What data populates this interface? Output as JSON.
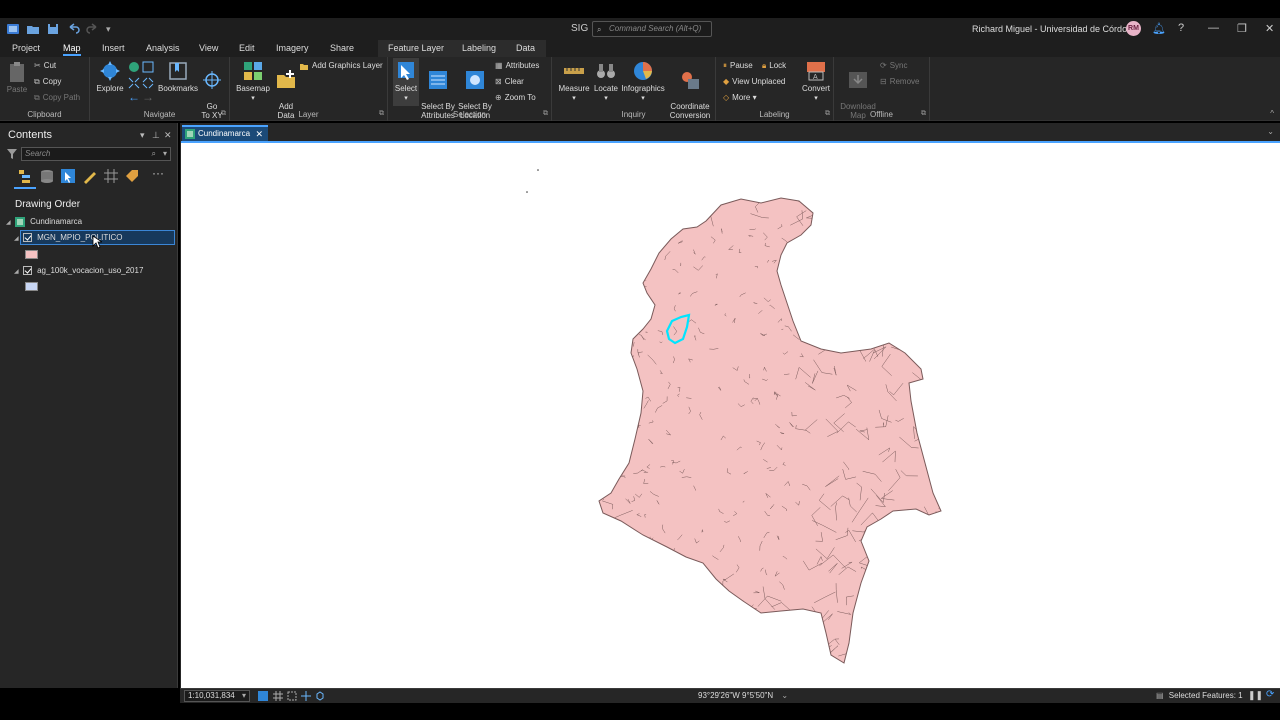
{
  "app": {
    "title": "SIG",
    "command_search_placeholder": "Command Search (Alt+Q)",
    "user": "Richard Miguel - Universidad de Córdoba",
    "avatar_initials": "RM"
  },
  "ribbon_tabs": [
    "Project",
    "Map",
    "Insert",
    "Analysis",
    "View",
    "Edit",
    "Imagery",
    "Share",
    "Feature Layer",
    "Labeling",
    "Data"
  ],
  "active_tab": "Map",
  "ribbon": {
    "clipboard": {
      "label": "Clipboard",
      "paste": "Paste",
      "cut": "Cut",
      "copy": "Copy",
      "copy_path": "Copy Path"
    },
    "navigate": {
      "label": "Navigate",
      "explore": "Explore",
      "bookmarks": "Bookmarks",
      "goto_xy": "Go\nTo XY"
    },
    "layer": {
      "label": "Layer",
      "basemap": "Basemap",
      "add_data": "Add\nData",
      "add_graphics": "Add Graphics Layer"
    },
    "selection": {
      "label": "Selection",
      "select": "Select",
      "by_attributes": "Select By\nAttributes",
      "by_location": "Select By\nLocation",
      "attributes": "Attributes",
      "clear": "Clear",
      "zoom_to": "Zoom To"
    },
    "inquiry": {
      "label": "Inquiry",
      "measure": "Measure",
      "locate": "Locate",
      "infographics": "Infographics",
      "coordinate_conversion": "Coordinate\nConversion"
    },
    "labeling": {
      "label": "Labeling",
      "pause": "Pause",
      "lock": "Lock",
      "view_unplaced": "View Unplaced",
      "more": "More",
      "convert": "Convert"
    },
    "offline": {
      "label": "Offline",
      "download_map": "Download\nMap",
      "sync": "Sync",
      "remove": "Remove"
    }
  },
  "contents": {
    "title": "Contents",
    "search_placeholder": "Search",
    "drawing_order": "Drawing Order",
    "map_name": "Cundinamarca",
    "layers": [
      {
        "name": "MGN_MPIO_POLITICO",
        "checked": true,
        "selected": true,
        "swatch": "#f4c2c2"
      },
      {
        "name": "ag_100k_vocacion_uso_2017",
        "checked": true,
        "selected": false,
        "swatch": "#c9d7f5"
      }
    ]
  },
  "map_tab": {
    "title": "Cundinamarca"
  },
  "map": {
    "fill_color": "#f4c2c2",
    "stroke_color": "#7a5a5a",
    "highlight_color": "#00e5ff"
  },
  "status": {
    "scale": "1:10,031,834",
    "coordinates": "93°29'26\"W 9°5'50\"N",
    "selected_features": "Selected Features: 1"
  }
}
